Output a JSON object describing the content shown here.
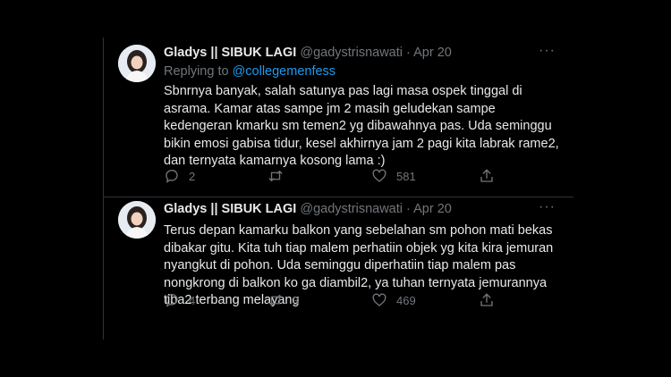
{
  "tweets": [
    {
      "name": "Gladys || SIBUK LAGI",
      "handle": "@gadystrisnawati",
      "separator": "·",
      "date": "Apr 20",
      "replying_prefix": "Replying to ",
      "replying_to": "@collegemenfess",
      "text": "Sbnrnya banyak, salah satunya pas lagi masa ospek tinggal di asrama. Kamar atas sampe jm 2 masih geludekan sampe kedengeran kmarku sm temen2 yg dibawahnya pas. Uda seminggu bikin emosi gabisa tidur, kesel akhirnya jam 2 pagi kita labrak rame2, dan ternyata kamarnya kosong lama :)",
      "reply_count": "2",
      "retweet_count": "",
      "like_count": "581"
    },
    {
      "name": "Gladys || SIBUK LAGI",
      "handle": "@gadystrisnawati",
      "separator": "·",
      "date": "Apr 20",
      "text": "Terus depan kamarku balkon yang sebelahan sm pohon mati bekas dibakar gitu. Kita tuh tiap malem perhatiin objek yg kita kira jemuran nyangkut di pohon. Uda seminggu diperhatiin tiap malem pas nongkrong di balkon ko ga diambil2,  ya tuhan ternyata jemurannya tiba2 terbang melayang",
      "reply_count": "4",
      "retweet_count": "3",
      "like_count": "469"
    }
  ],
  "icons": {
    "more": "more-horizontal-icon",
    "reply": "reply-icon",
    "retweet": "retweet-icon",
    "like": "heart-icon",
    "share": "share-icon"
  }
}
